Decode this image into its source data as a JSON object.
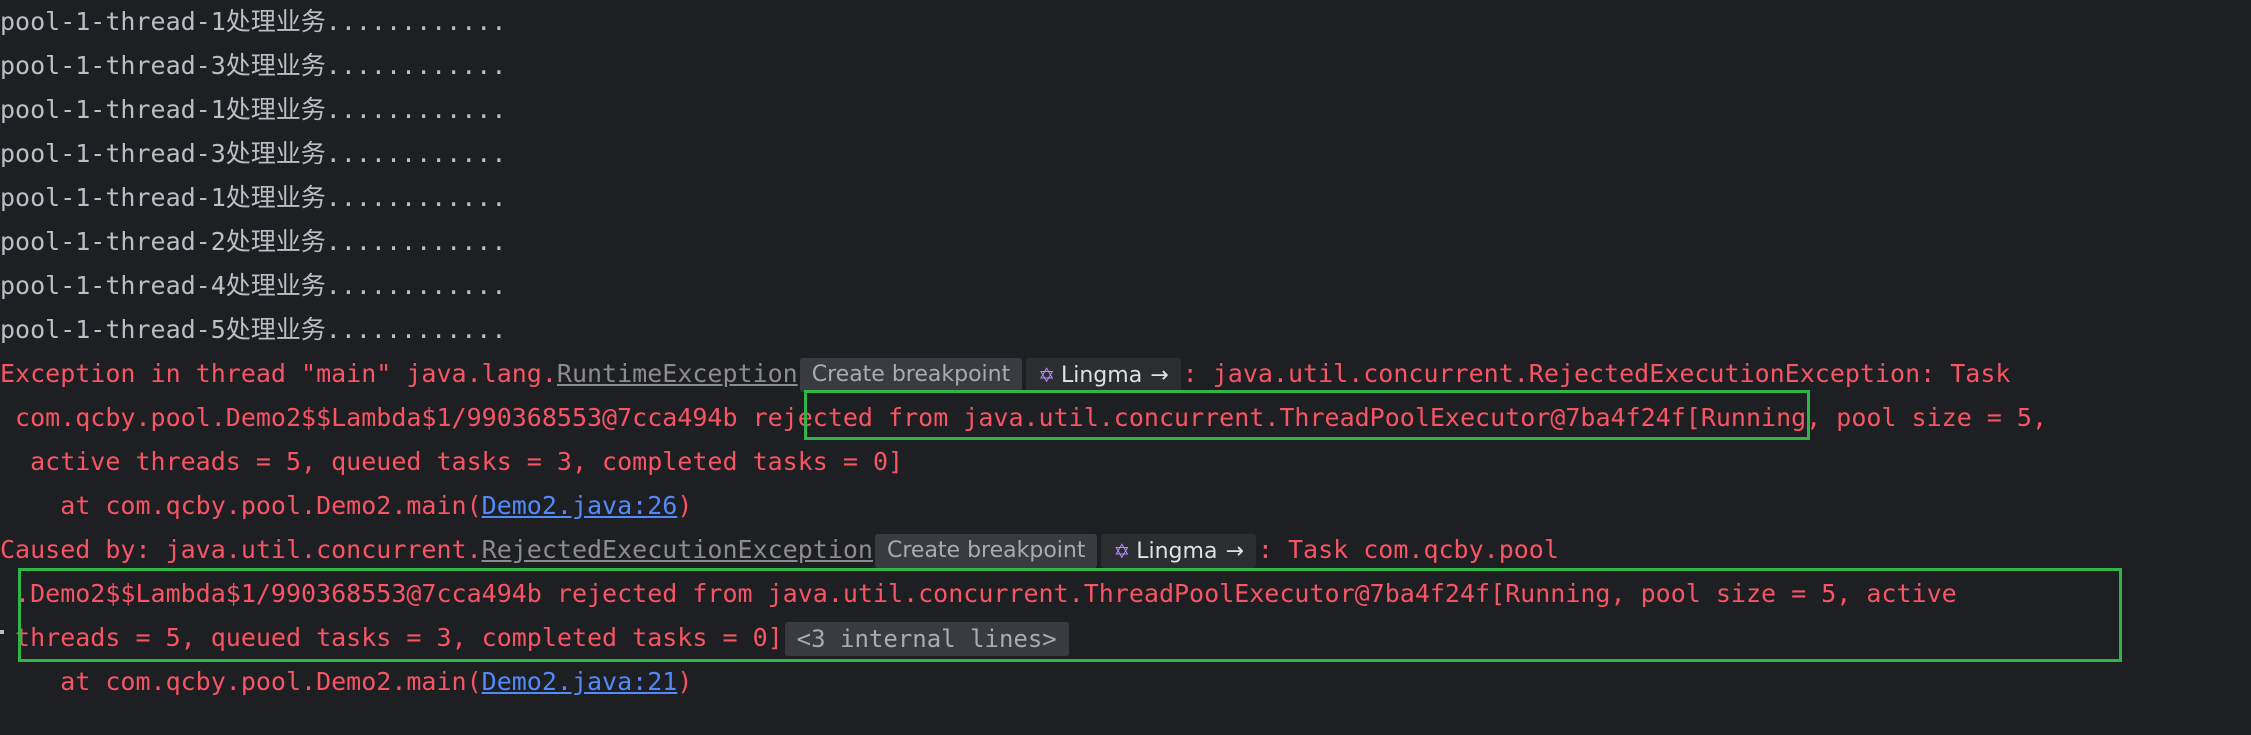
{
  "output_lines": [
    "pool-1-thread-1处理业务............",
    "pool-1-thread-3处理业务............",
    "pool-1-thread-1处理业务............",
    "pool-1-thread-3处理业务............",
    "pool-1-thread-1处理业务............",
    "pool-1-thread-2处理业务............",
    "pool-1-thread-4处理业务............",
    "pool-1-thread-5处理业务............"
  ],
  "exception": {
    "prefix": "Exception in thread \"main\" java.lang.",
    "class_link": "RuntimeException",
    "suffix": ": java.util.concurrent.RejectedExecutionException: Task",
    "line2_a": " com.qcby.pool.Demo2$$Lambda$1/990368553@7cca494b ",
    "line2_b": "rejected from java.util.concurrent.ThreadPoolExecutor@7ba4f24f",
    "line2_c": "[Running, pool size = 5,",
    "line3": "  active threads = 5, queued tasks = 3, completed tasks = 0]",
    "at_prefix": "    at com.qcby.pool.Demo2.main(",
    "at_link": "Demo2.java:26",
    "at_suffix": ")"
  },
  "caused_by": {
    "prefix": "Caused by: java.util.concurrent.",
    "class_link": "RejectedExecutionException",
    "suffix": ": Task com.qcby.pool",
    "line2": " .Demo2$$Lambda$1/990368553@7cca494b rejected from java.util.concurrent.ThreadPoolExecutor@7ba4f24f[Running, pool size = 5, active",
    "line3": " threads = 5, queued tasks = 3, completed tasks = 0]",
    "internal_lines": "<3 internal lines>",
    "at_prefix": "    at com.qcby.pool.Demo2.main(",
    "at_link": "Demo2.java:21",
    "at_suffix": ")"
  },
  "chips": {
    "create_breakpoint": "Create breakpoint",
    "lingma": "Lingma",
    "lingma_arrow": "→"
  },
  "colors": {
    "background": "#1e1f22",
    "stdout": "#bcbec4",
    "stderr": "#f75464",
    "link": "#548af7",
    "highlight_box": "#2fb648"
  }
}
